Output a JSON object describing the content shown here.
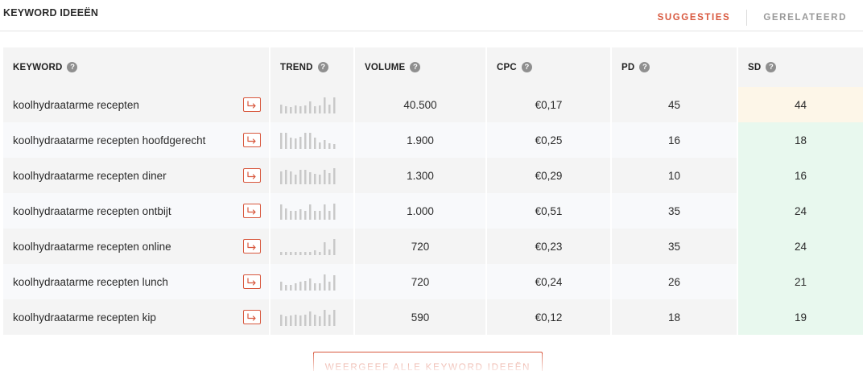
{
  "title": "KEYWORD IDEEËN",
  "tabs": [
    {
      "label": "SUGGESTIES",
      "active": true
    },
    {
      "label": "GERELATEERD",
      "active": false
    }
  ],
  "columns": {
    "keyword": "KEYWORD",
    "trend": "TREND",
    "volume": "VOLUME",
    "cpc": "CPC",
    "pd": "PD",
    "sd": "SD",
    "help_glyph": "?"
  },
  "rows": [
    {
      "keyword": "koolhydraatarme recepten",
      "volume": "40.500",
      "cpc": "€0,17",
      "pd": "45",
      "sd": "44",
      "sd_color": "#fdf6e8",
      "trend": [
        0.55,
        0.45,
        0.4,
        0.5,
        0.45,
        0.5,
        0.75,
        0.45,
        0.5,
        1.0,
        0.55,
        1.0
      ]
    },
    {
      "keyword": "koolhydraatarme recepten hoofdgerecht",
      "volume": "1.900",
      "cpc": "€0,25",
      "pd": "16",
      "sd": "18",
      "sd_color": "#e8f8ee",
      "trend": [
        1.0,
        1.0,
        0.7,
        0.65,
        0.75,
        1.0,
        1.0,
        0.7,
        0.4,
        0.55,
        0.35,
        0.3
      ]
    },
    {
      "keyword": "koolhydraatarme recepten diner",
      "volume": "1.300",
      "cpc": "€0,29",
      "pd": "10",
      "sd": "16",
      "sd_color": "#e8f8ee",
      "trend": [
        0.8,
        0.9,
        0.8,
        0.6,
        0.9,
        0.9,
        0.75,
        0.65,
        0.6,
        0.9,
        0.7,
        1.0
      ]
    },
    {
      "keyword": "koolhydraatarme recepten ontbijt",
      "volume": "1.000",
      "cpc": "€0,51",
      "pd": "35",
      "sd": "24",
      "sd_color": "#e8f8ee",
      "trend": [
        0.95,
        0.7,
        0.55,
        0.55,
        0.65,
        0.55,
        0.95,
        0.55,
        0.55,
        0.95,
        0.55,
        1.0
      ]
    },
    {
      "keyword": "koolhydraatarme recepten online",
      "volume": "720",
      "cpc": "€0,23",
      "pd": "35",
      "sd": "24",
      "sd_color": "#e8f8ee",
      "trend": [
        0.2,
        0.2,
        0.2,
        0.2,
        0.2,
        0.2,
        0.2,
        0.3,
        0.2,
        0.8,
        0.35,
        1.0
      ]
    },
    {
      "keyword": "koolhydraatarme recepten lunch",
      "volume": "720",
      "cpc": "€0,24",
      "pd": "26",
      "sd": "21",
      "sd_color": "#e8f8ee",
      "trend": [
        0.55,
        0.35,
        0.35,
        0.45,
        0.55,
        0.6,
        0.75,
        0.45,
        0.45,
        1.0,
        0.55,
        0.95
      ]
    },
    {
      "keyword": "koolhydraatarme recepten kip",
      "volume": "590",
      "cpc": "€0,12",
      "pd": "18",
      "sd": "19",
      "sd_color": "#e8f8ee",
      "trend": [
        0.7,
        0.6,
        0.65,
        0.7,
        0.65,
        0.7,
        0.9,
        0.7,
        0.6,
        1.0,
        0.7,
        1.0
      ]
    }
  ],
  "footer_button": "WEERGEEF ALLE KEYWORD IDEEËN",
  "colors": {
    "accent": "#d8573d",
    "bar": "#c9c9c9"
  }
}
